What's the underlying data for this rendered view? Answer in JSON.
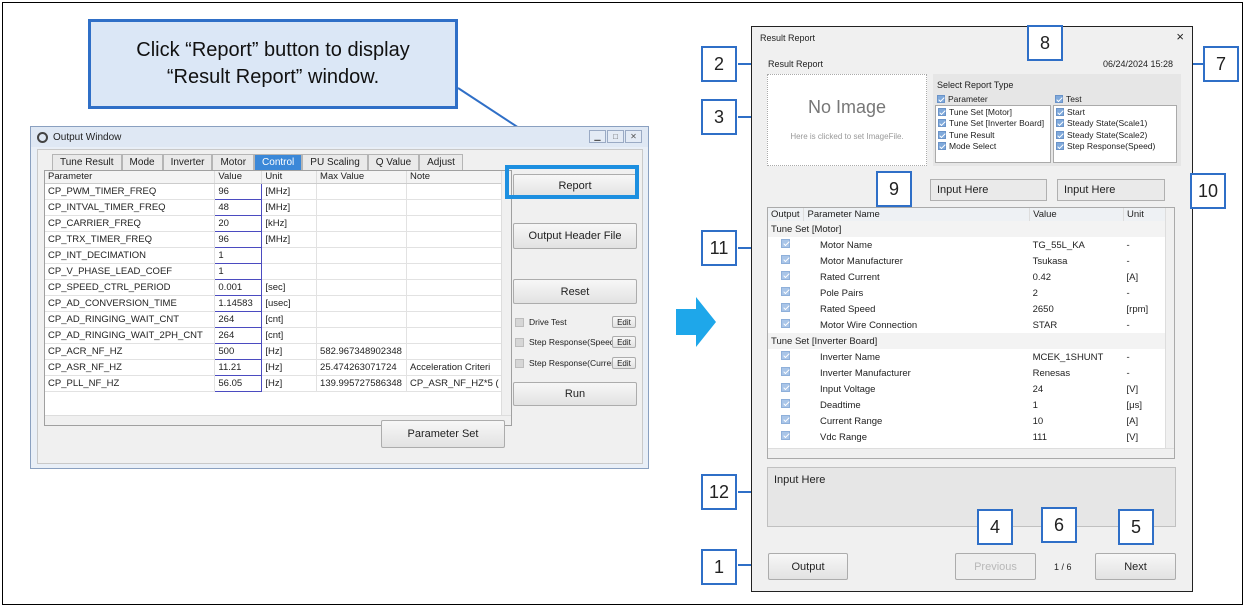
{
  "callout": {
    "line1": "Click “Report” button to display",
    "line2": "“Result Report” window."
  },
  "output_window": {
    "title": "Output Window",
    "tabs": [
      "Tune Result",
      "Mode",
      "Inverter",
      "Motor",
      "Control",
      "PU Scaling",
      "Q Value",
      "Adjust"
    ],
    "active_tab": "Control",
    "columns": [
      "Parameter",
      "Value",
      "Unit",
      "Max Value",
      "Note"
    ],
    "rows": [
      [
        "CP_PWM_TIMER_FREQ",
        "96",
        "[MHz]",
        "",
        ""
      ],
      [
        "CP_INTVAL_TIMER_FREQ",
        "48",
        "[MHz]",
        "",
        ""
      ],
      [
        "CP_CARRIER_FREQ",
        "20",
        "[kHz]",
        "",
        ""
      ],
      [
        "CP_TRX_TIMER_FREQ",
        "96",
        "[MHz]",
        "",
        ""
      ],
      [
        "CP_INT_DECIMATION",
        "1",
        "",
        "",
        ""
      ],
      [
        "CP_V_PHASE_LEAD_COEF",
        "1",
        "",
        "",
        ""
      ],
      [
        "CP_SPEED_CTRL_PERIOD",
        "0.001",
        "[sec]",
        "",
        ""
      ],
      [
        "CP_AD_CONVERSION_TIME",
        "1.14583",
        "[usec]",
        "",
        ""
      ],
      [
        "CP_AD_RINGING_WAIT_CNT",
        "264",
        "[cnt]",
        "",
        ""
      ],
      [
        "CP_AD_RINGING_WAIT_2PH_CNT",
        "264",
        "[cnt]",
        "",
        ""
      ],
      [
        "CP_ACR_NF_HZ",
        "500",
        "[Hz]",
        "582.967348902348",
        ""
      ],
      [
        "CP_ASR_NF_HZ",
        "11.21",
        "[Hz]",
        "25.474263071724",
        "Acceleration Criteri"
      ],
      [
        "CP_PLL_NF_HZ",
        "56.05",
        "[Hz]",
        "139.995727586348",
        "CP_ASR_NF_HZ*5 ("
      ]
    ],
    "buttons": {
      "report": "Report",
      "output_header": "Output Header File",
      "reset": "Reset",
      "run": "Run",
      "parameter_set": "Parameter Set"
    },
    "checks": [
      {
        "label": "Drive Test",
        "edit": "Edit"
      },
      {
        "label": "Step Response(Speed)",
        "edit": "Edit"
      },
      {
        "label": "Step Response(Current)",
        "edit": "Edit"
      }
    ]
  },
  "result_report": {
    "window_title": "Result Report",
    "close": "×",
    "heading": "Result Report",
    "datetime": "06/24/2024 15:28",
    "no_image": "No Image",
    "no_image_hint": "Here is clicked to set ImageFile.",
    "select_report_type": "Select Report Type",
    "param_group": "Parameter",
    "param_items": [
      "Tune Set [Motor]",
      "Tune Set [Inverter Board]",
      "Tune Result",
      "Mode Select"
    ],
    "test_group": "Test",
    "test_items": [
      "Start",
      "Steady State(Scale1)",
      "Steady State(Scale2)",
      "Step Response(Speed)"
    ],
    "input_left": "Input Here",
    "input_right": "Input Here",
    "columns": [
      "Output",
      "Parameter Name",
      "Value",
      "Unit"
    ],
    "groups": [
      {
        "name": "Tune Set [Motor]",
        "rows": [
          [
            "Motor Name",
            "TG_55L_KA",
            "-"
          ],
          [
            "Motor Manufacturer",
            "Tsukasa",
            "-"
          ],
          [
            "Rated Current",
            "0.42",
            "[A]"
          ],
          [
            "Pole Pairs",
            "2",
            "-"
          ],
          [
            "Rated Speed",
            "2650",
            "[rpm]"
          ],
          [
            "Motor Wire Connection",
            "STAR",
            "-"
          ]
        ]
      },
      {
        "name": "Tune Set [Inverter Board]",
        "rows": [
          [
            "Inverter Name",
            "MCEK_1SHUNT",
            "-"
          ],
          [
            "Inverter Manufacturer",
            "Renesas",
            "-"
          ],
          [
            "Input Voltage",
            "24",
            "[V]"
          ],
          [
            "Deadtime",
            "1",
            "[μs]"
          ],
          [
            "Current Range",
            "10",
            "[A]"
          ],
          [
            "Vdc Range",
            "111",
            "[V]"
          ]
        ]
      }
    ],
    "comment": "Input Here",
    "output_button": "Output",
    "previous_button": "Previous",
    "page": "1 / 6",
    "next_button": "Next"
  },
  "callout_numbers": [
    "1",
    "2",
    "3",
    "4",
    "5",
    "6",
    "7",
    "8",
    "9",
    "10",
    "11",
    "12"
  ],
  "colors": {
    "callout_border": "#2f6fc7",
    "callout_fill": "#dbe7f6",
    "highlight": "#1c8fe0",
    "active_tab": "#3b88d8"
  }
}
